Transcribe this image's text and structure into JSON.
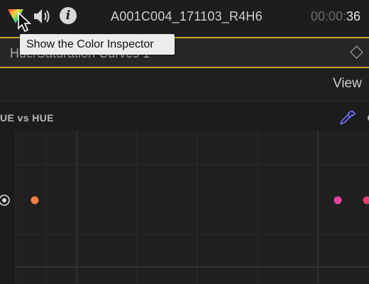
{
  "toolbar": {
    "color_inspector_icon": "color-inspector-icon",
    "audio_icon": "speaker-icon",
    "info_icon": "info-icon",
    "info_glyph": "i",
    "clip_name": "A001C004_171103_R4H6",
    "timecode_dim": "00:00:",
    "timecode_bright": "36"
  },
  "tooltip": {
    "text": "Show the Color Inspector"
  },
  "effect": {
    "name": "Hue/Saturation Curves 1"
  },
  "view": {
    "label": "View"
  },
  "curve": {
    "title": "UE vs HUE",
    "control_points": [
      {
        "name": "red-orange",
        "color": "#f07e4a"
      },
      {
        "name": "magenta",
        "color": "#e8449a"
      },
      {
        "name": "red-edge",
        "color": "#e8406e"
      }
    ]
  },
  "colors": {
    "accent_yellow": "#c6a62a",
    "background": "#1c1c1d",
    "eyedropper": "#6b6df2"
  }
}
